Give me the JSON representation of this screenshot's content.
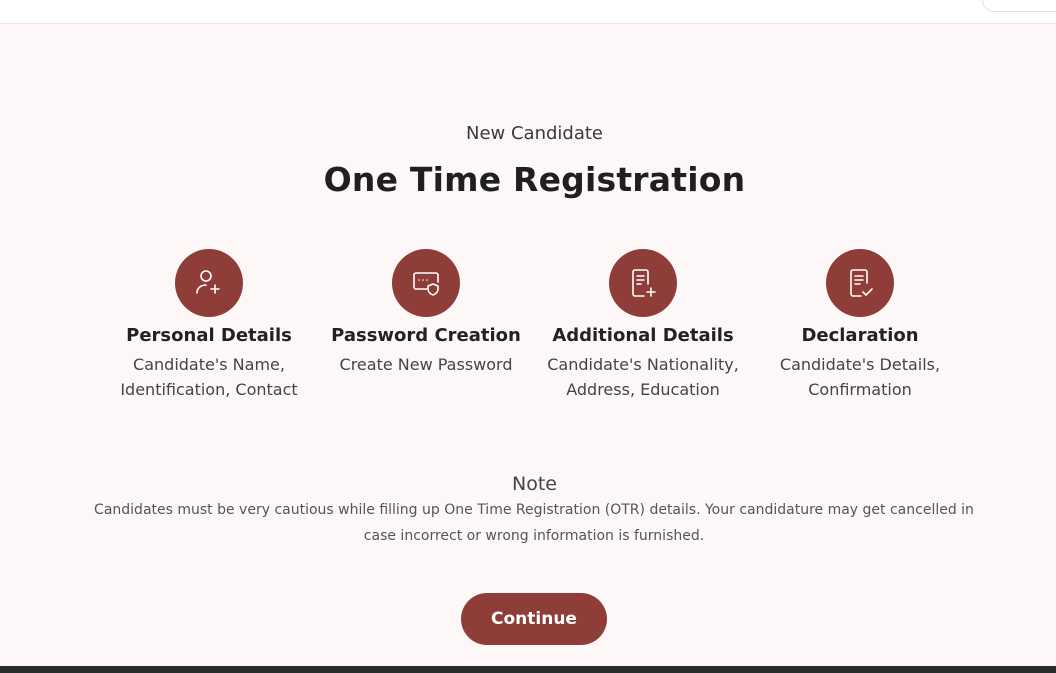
{
  "header": {},
  "main": {
    "subtitle": "New Candidate",
    "title": "One Time Registration",
    "steps": [
      {
        "title": "Personal Details",
        "description": "Candidate's Name, Identification, Contact",
        "icon": "user-plus-icon"
      },
      {
        "title": "Password Creation",
        "description": "Create New Password",
        "icon": "password-shield-icon"
      },
      {
        "title": "Additional Details",
        "description": "Candidate's Nationality, Address, Education",
        "icon": "document-add-icon"
      },
      {
        "title": "Declaration",
        "description": "Candidate's Details, Confirmation",
        "icon": "document-check-icon"
      }
    ],
    "note": {
      "title": "Note",
      "text": "Candidates must be very cautious while filling up One Time Registration (OTR) details. Your candidature may get cancelled in case incorrect or wrong information is furnished."
    },
    "continue_label": "Continue"
  },
  "colors": {
    "accent": "#8f3d38",
    "background": "#fdf8f7"
  }
}
